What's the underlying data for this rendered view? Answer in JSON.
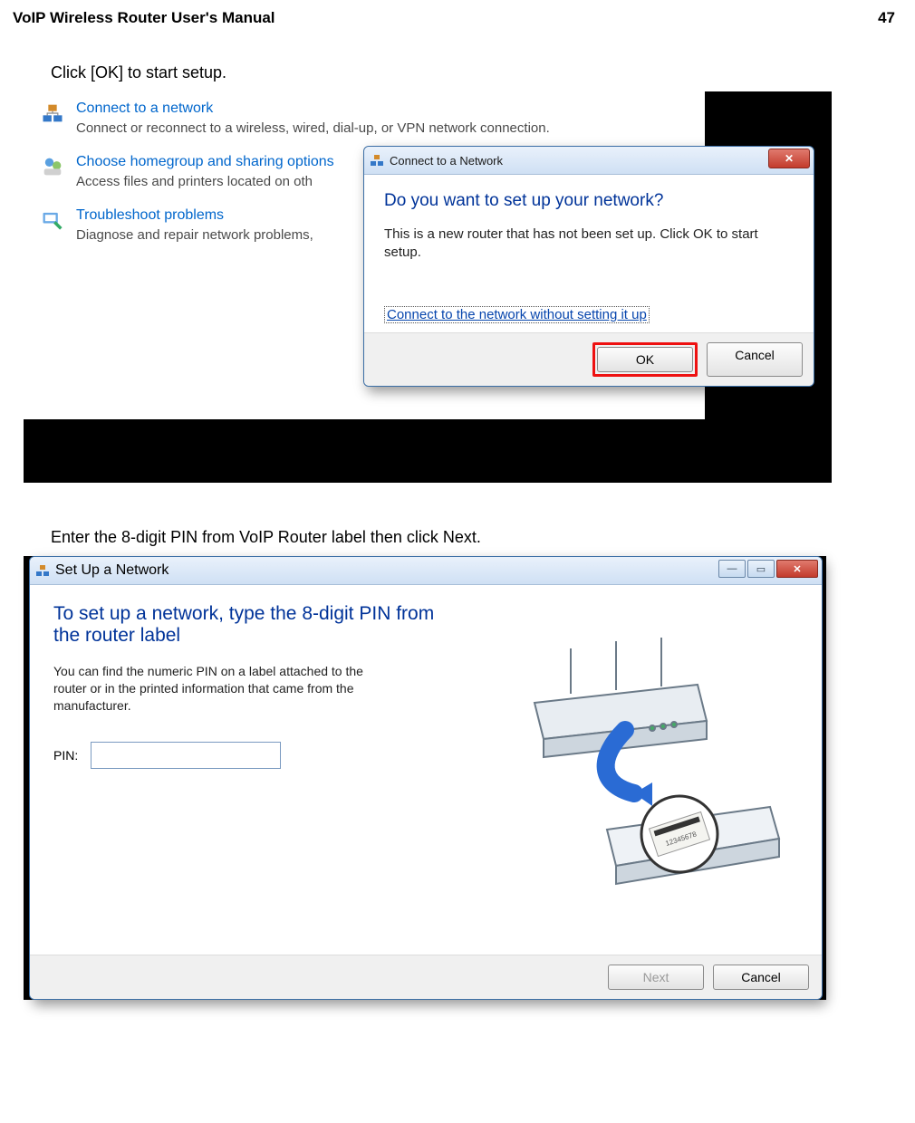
{
  "header": {
    "title": "VoIP Wireless Router User's Manual",
    "page": "47"
  },
  "instruction1": "Click [OK] to start setup.",
  "net_entries": [
    {
      "title": "Connect to a network",
      "desc": "Connect or reconnect to a wireless, wired, dial-up, or VPN network connection."
    },
    {
      "title": "Choose homegroup and sharing options",
      "desc": "Access files and printers located on oth"
    },
    {
      "title": "Troubleshoot problems",
      "desc": "Diagnose and repair network problems,"
    }
  ],
  "dlg1": {
    "title": "Connect to a Network",
    "question": "Do you want to set up your network?",
    "body": "This is a new router that has not been set up. Click OK to start setup.",
    "link": "Connect to the network without setting it up",
    "ok": "OK",
    "cancel": "Cancel"
  },
  "instruction2": "Enter the 8-digit PIN from VoIP Router label then click Next.",
  "dlg2": {
    "title": "Set Up a Network",
    "heading": "To set up a network, type the 8-digit PIN from the router label",
    "para": "You can find the numeric PIN on a label attached to the router or in the printed information that came from the manufacturer.",
    "pin_label": "PIN:",
    "pin_value": "",
    "next": "Next",
    "cancel": "Cancel"
  }
}
